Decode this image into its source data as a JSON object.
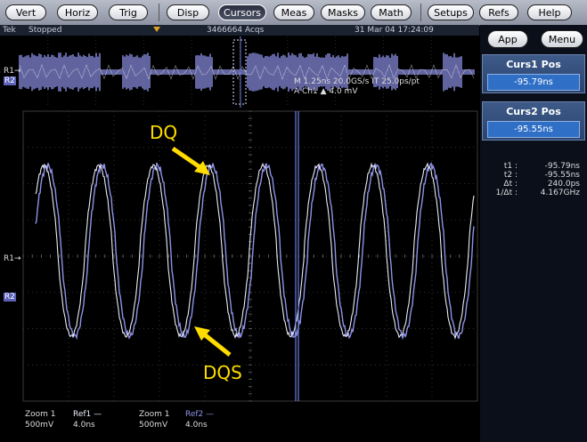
{
  "menu": {
    "vert": "Vert",
    "horiz": "Horiz",
    "trig": "Trig",
    "disp": "Disp",
    "cursors": "Cursors",
    "meas": "Meas",
    "masks": "Masks",
    "math": "Math",
    "setups": "Setups",
    "refs": "Refs",
    "help": "Help"
  },
  "status": {
    "brand": "Tek",
    "state": "Stopped",
    "acqs": "3466664 Acqs",
    "datetime": "31 Mar 04 17:24:09"
  },
  "overview": {
    "r1": "R1",
    "r2": "R2",
    "timebase_line1": "M 1.25ns   20.0GS/s    IT 25.0ps/pt",
    "timebase_line2": "A  Ch1 ▲           4.0 mV"
  },
  "main": {
    "r1": "R1",
    "r2": "R2",
    "label_dq": "DQ",
    "label_dqs": "DQS"
  },
  "bottom": {
    "ref1": {
      "zoom": "Zoom 1",
      "ref": "Ref1 —",
      "volts": "500mV",
      "time": "4.0ns"
    },
    "ref2": {
      "zoom": "Zoom 1",
      "ref": "Ref2 —",
      "volts": "500mV",
      "time": "4.0ns"
    }
  },
  "panel": {
    "app": "App",
    "menu": "Menu",
    "curs1_title": "Curs1 Pos",
    "curs1_value": "-95.79ns",
    "curs2_title": "Curs2 Pos",
    "curs2_value": "-95.55ns",
    "readout": [
      {
        "k": "t1 :",
        "v": "-95.79ns"
      },
      {
        "k": "t2 :",
        "v": "-95.55ns"
      },
      {
        "k": "Δt :",
        "v": "240.0ps"
      },
      {
        "k": "1/Δt :",
        "v": "4.167GHz"
      }
    ]
  },
  "colors": {
    "trace_dq": "#e8ecf8",
    "trace_dqs": "#8f92e8",
    "cursor": "#6e7fe8",
    "annotation": "#ffdd00",
    "accent": "#2f6fc6",
    "marker": "#e0a020"
  },
  "icons": {
    "trigger_marker": "triangle-down-icon",
    "ref_marker": "arrow-right-icon"
  }
}
